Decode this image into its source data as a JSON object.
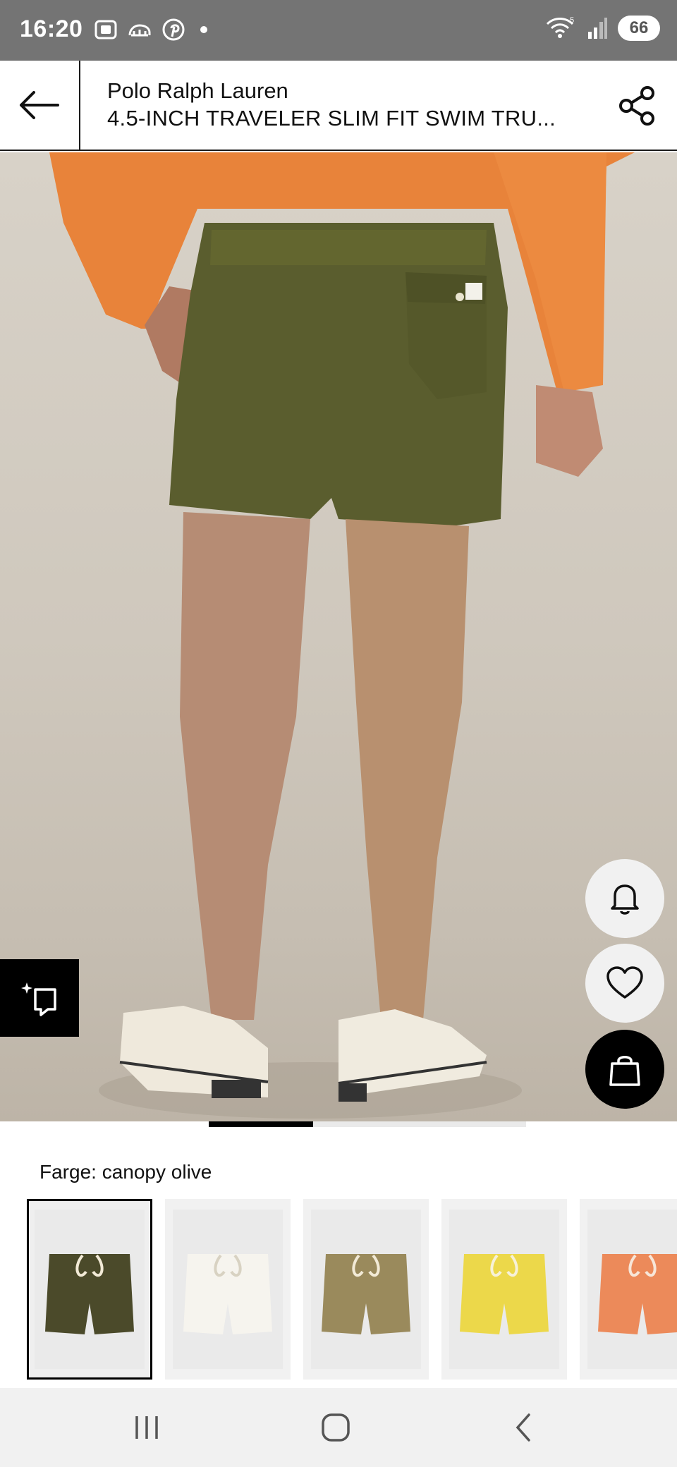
{
  "status_bar": {
    "time": "16:20",
    "battery": "66",
    "icons_left": [
      "screenshot-icon",
      "cloud-icon",
      "pinterest-icon"
    ],
    "icons_right": [
      "wifi-icon",
      "signal-icon"
    ]
  },
  "header": {
    "brand": "Polo Ralph Lauren",
    "product_name": "4.5-INCH TRAVELER SLIM FIT SWIM TRU...",
    "back_icon": "arrow-left-icon",
    "share_icon": "share-icon"
  },
  "product": {
    "image_alt": "Back view of model wearing olive swim trunks",
    "pager": {
      "current": 1,
      "total": 3
    }
  },
  "actions": {
    "ai_icon": "sparkle-tag-icon",
    "notify_icon": "bell-icon",
    "wishlist_icon": "heart-icon",
    "cart_icon": "bag-icon"
  },
  "color": {
    "label": "Farge: canopy olive",
    "swatches": [
      {
        "name": "canopy olive",
        "color": "#4b4a2a",
        "selected": true
      },
      {
        "name": "white",
        "color": "#f3f1ea",
        "selected": false
      },
      {
        "name": "khaki",
        "color": "#9a8a5c",
        "selected": false
      },
      {
        "name": "yellow",
        "color": "#ecd84a",
        "selected": false
      },
      {
        "name": "orange",
        "color": "#ec8a5a",
        "selected": false
      }
    ]
  },
  "nav": {
    "recent_icon": "recent-apps-icon",
    "home_icon": "home-icon",
    "back_icon": "nav-back-icon"
  }
}
